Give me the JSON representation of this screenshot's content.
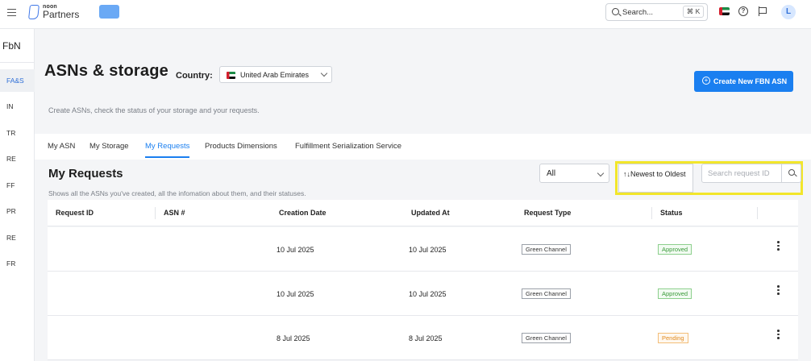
{
  "topbar": {
    "logo_small": "noon",
    "logo_main": "Partners",
    "search_placeholder": "Search...",
    "search_shortcut": "⌘ K",
    "help_symbol": "?",
    "avatar_initial": "L"
  },
  "sidebar": {
    "title": "FbN",
    "items": [
      {
        "label": "FA&S",
        "active": true
      },
      {
        "label": "IN"
      },
      {
        "label": "TR"
      },
      {
        "label": "RE"
      },
      {
        "label": "FF"
      },
      {
        "label": "PR"
      },
      {
        "label": "RE"
      },
      {
        "label": "FR"
      }
    ]
  },
  "header": {
    "title": "ASNs & storage",
    "country_label": "Country:",
    "country_value": "United Arab Emirates",
    "create_button": "Create New FBN ASN",
    "create_plus": "+",
    "subtitle": "Create ASNs, check the status of your storage and your requests."
  },
  "tabs": [
    {
      "label": "My ASN"
    },
    {
      "label": "My Storage"
    },
    {
      "label": "My Requests",
      "active": true
    },
    {
      "label": "Products Dimensions"
    },
    {
      "label": "Fulfillment Serialization Service"
    }
  ],
  "requests": {
    "title": "My Requests",
    "subtitle": "Shows all the ASNs you've created, all the infomation about them, and their statuses.",
    "filter_value": "All",
    "sort_label": "↑↓Newest to Oldest",
    "search_placeholder": "Search request ID"
  },
  "table": {
    "columns": [
      "Request ID",
      "ASN #",
      "Creation Date",
      "Updated At",
      "Request Type",
      "Status"
    ],
    "rows": [
      {
        "request_id": "",
        "asn": "",
        "creation_date": "10 Jul 2025",
        "updated_at": "10 Jul 2025",
        "request_type": "Green Channel",
        "status": "Approved"
      },
      {
        "request_id": "",
        "asn": "",
        "creation_date": "10 Jul 2025",
        "updated_at": "10 Jul 2025",
        "request_type": "Green Channel",
        "status": "Approved"
      },
      {
        "request_id": "",
        "asn": "",
        "creation_date": "8 Jul 2025",
        "updated_at": "8 Jul 2025",
        "request_type": "Green Channel",
        "status": "Pending"
      }
    ]
  },
  "colors": {
    "primary": "#1a7ff0",
    "highlight": "#f2e62a",
    "approved": "#3a9a3a",
    "pending": "#e08a1f"
  }
}
